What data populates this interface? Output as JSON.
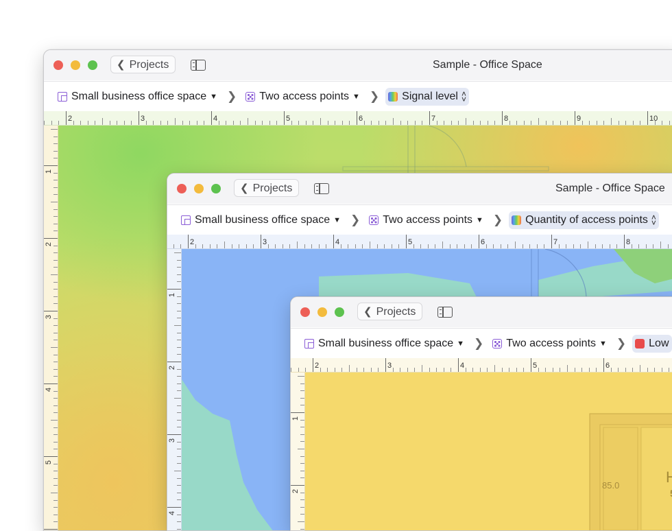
{
  "windows": [
    {
      "title": "Sample - Office Space",
      "back_label": "Projects",
      "breadcrumbs": [
        {
          "label": "Small business office space",
          "icon": "floorplan-icon",
          "type": "dropdown"
        },
        {
          "label": "Two access points",
          "icon": "dice-icon",
          "type": "dropdown"
        },
        {
          "label": "Signal level",
          "icon": "gradient-icon",
          "type": "stepper",
          "selected": true
        }
      ],
      "ruler_x": [
        "2",
        "3",
        "4",
        "5",
        "6",
        "7",
        "8",
        "9",
        "10"
      ],
      "ruler_y": [
        "1",
        "2",
        "3",
        "4",
        "5"
      ]
    },
    {
      "title": "Sample - Office Space",
      "back_label": "Projects",
      "breadcrumbs": [
        {
          "label": "Small business office space",
          "icon": "floorplan-icon",
          "type": "dropdown"
        },
        {
          "label": "Two access points",
          "icon": "dice-icon",
          "type": "dropdown"
        },
        {
          "label": "Quantity of access points",
          "icon": "gradient-icon",
          "type": "stepper",
          "selected": true
        }
      ],
      "ruler_x": [
        "2",
        "3",
        "4",
        "5",
        "6",
        "7",
        "8"
      ],
      "ruler_y": [
        "1",
        "2",
        "3",
        "4"
      ]
    },
    {
      "title": "",
      "back_label": "Projects",
      "breadcrumbs": [
        {
          "label": "Small business office space",
          "icon": "floorplan-icon",
          "type": "dropdown"
        },
        {
          "label": "Two access points",
          "icon": "dice-icon",
          "type": "dropdown"
        },
        {
          "label": "Low",
          "icon": "red-square-icon",
          "type": "stepper",
          "selected": true
        }
      ],
      "ruler_x": [
        "2",
        "3",
        "4",
        "5",
        "6"
      ],
      "ruler_y": [
        "1",
        "2"
      ],
      "canvas_labels": [
        "85.0",
        "H",
        "5"
      ]
    }
  ],
  "colors": {
    "signal_green": "#8fd861",
    "signal_yellow": "#f0c35a",
    "quantity_blue": "#89b4f6",
    "quantity_teal": "#98d9c8",
    "low_yellow": "#f5d96c",
    "accent_selected": "#e3e8f4"
  }
}
